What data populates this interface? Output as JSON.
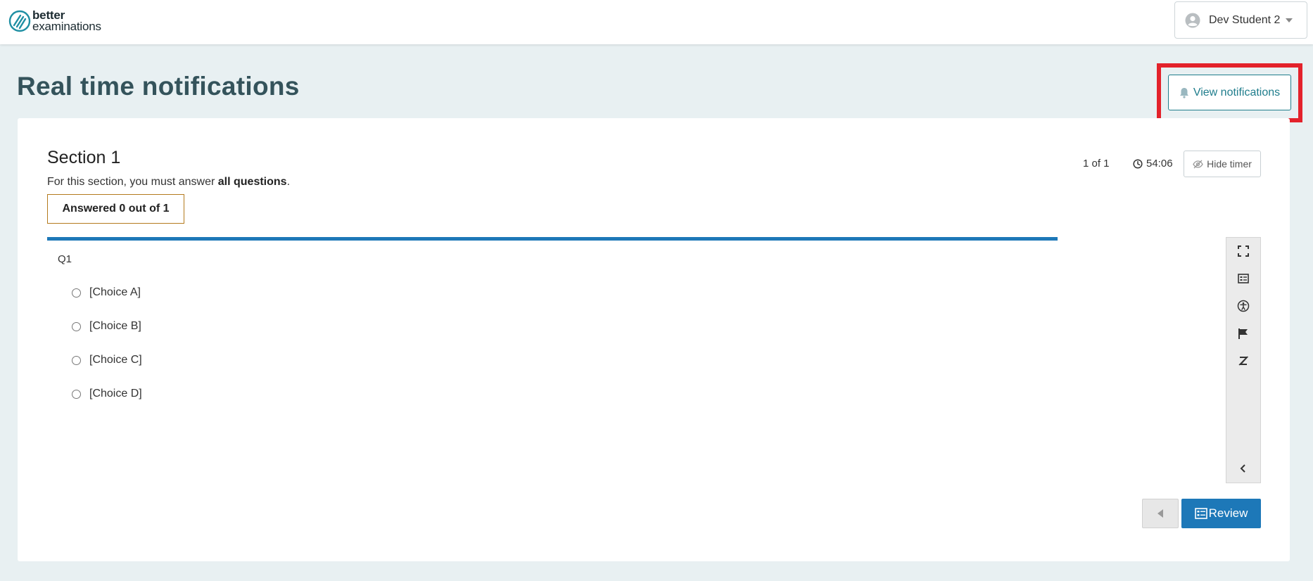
{
  "header": {
    "logo_line1": "better",
    "logo_line2": "examinations",
    "user_name": "Dev Student 2"
  },
  "page": {
    "title": "Real time notifications",
    "view_notifications_label": "View notifications",
    "highlight_color": "#e3222b"
  },
  "section": {
    "title": "Section 1",
    "instruction_prefix": "For this section, you must answer ",
    "instruction_bold": "all questions",
    "instruction_suffix": ".",
    "answered_status": "Answered 0 out of 1",
    "pager": "1 of 1",
    "timer": "54:06",
    "hide_timer_label": "Hide timer"
  },
  "question": {
    "label": "Q1",
    "choices": [
      "[Choice A]",
      "[Choice B]",
      "[Choice C]",
      "[Choice D]"
    ]
  },
  "toolbar": {
    "tools": [
      "fullscreen-icon",
      "review-list-icon",
      "accessibility-icon",
      "flag-icon",
      "strikethrough-icon",
      "collapse-chevron-icon"
    ]
  },
  "footer": {
    "review_label": "Review"
  },
  "colors": {
    "accent": "#1d78b8",
    "teal": "#1f7d8c",
    "title": "#34535b",
    "answered_border": "#b47a1d"
  }
}
